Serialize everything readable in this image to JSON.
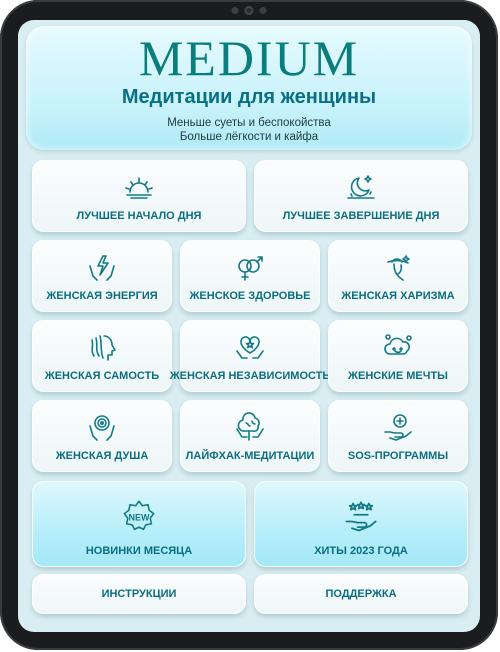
{
  "header": {
    "logo": "MEDIUM",
    "subtitle": "Медитации для женщины",
    "tagline_1": "Меньше суеты и беспокойства",
    "tagline_2": "Больше лёгкости и кайфа"
  },
  "tiles": {
    "best_start": "ЛУЧШЕЕ НАЧАЛО ДНЯ",
    "best_end": "ЛУЧШЕЕ ЗАВЕРШЕНИЕ ДНЯ",
    "energy": "ЖЕНСКАЯ ЭНЕРГИЯ",
    "health": "ЖЕНСКОЕ ЗДОРОВЬЕ",
    "charisma": "ЖЕНСКАЯ ХАРИЗМА",
    "self": "ЖЕНСКАЯ САМОСТЬ",
    "independence": "ЖЕНСКАЯ НЕЗАВИСИМОСТЬ",
    "dreams": "ЖЕНСКИЕ МЕЧТЫ",
    "soul": "ЖЕНСКАЯ ДУША",
    "lifehack": "ЛАЙФХАК-МЕДИТАЦИИ",
    "sos": "SOS-ПРОГРАММЫ",
    "new_month": "НОВИНКИ МЕСЯЦА",
    "new_badge": "NEW",
    "hits": "ХИТЫ 2023 ГОДА",
    "instructions": "ИНСТРУКЦИИ",
    "support": "ПОДДЕРЖКА"
  },
  "icons": {
    "best_start": "sunrise-icon",
    "best_end": "moon-stars-icon",
    "energy": "hands-lightning-icon",
    "health": "gender-symbols-icon",
    "charisma": "woman-hat-icon",
    "self": "woman-profile-icon",
    "independence": "hands-heart-icon",
    "dreams": "cloud-dream-icon",
    "soul": "hands-spiral-icon",
    "lifehack": "head-brain-icon",
    "sos": "hand-plus-icon",
    "new_month": "new-badge-icon",
    "hits": "hand-stars-icon"
  },
  "colors": {
    "accent": "#0b6e80",
    "logo": "#0a7e7c",
    "header_bg": "#c5f1fa"
  }
}
